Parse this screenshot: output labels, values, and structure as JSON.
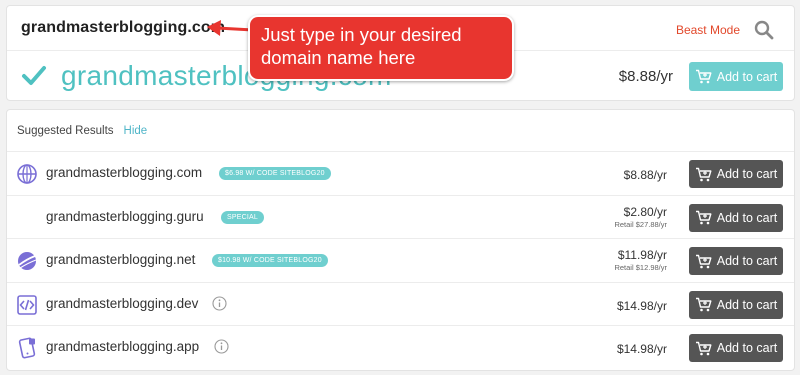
{
  "search": {
    "value": "grandmasterblogging.com",
    "beast_mode": "Beast Mode",
    "icon": "search-icon"
  },
  "main_result": {
    "domain": "grandmasterblogging.com",
    "price": "$8.88/yr",
    "button": "Add to cart",
    "status_icon": "check-icon"
  },
  "callout": {
    "line1": "Just type in your desired",
    "line2": "domain name here"
  },
  "suggestions": {
    "title": "Suggested Results",
    "hide": "Hide",
    "rows": [
      {
        "domain": "grandmasterblogging.com",
        "badge": "$6.98 W/ CODE SITEBLOG20",
        "price": "$8.88/yr",
        "retail": "",
        "button": "Add to cart",
        "icon": "globe-icon"
      },
      {
        "domain": "grandmasterblogging.guru",
        "badge": "SPECIAL",
        "price": "$2.80/yr",
        "retail": "Retail $27.88/yr",
        "button": "Add to cart",
        "icon": ""
      },
      {
        "domain": "grandmasterblogging.net",
        "badge": "$10.98 W/ CODE SITEBLOG20",
        "price": "$11.98/yr",
        "retail": "Retail $12.98/yr",
        "button": "Add to cart",
        "icon": "planet-icon"
      },
      {
        "domain": "grandmasterblogging.dev",
        "badge": "",
        "price": "$14.98/yr",
        "retail": "",
        "button": "Add to cart",
        "icon": "code-icon"
      },
      {
        "domain": "grandmasterblogging.app",
        "badge": "",
        "price": "$14.98/yr",
        "retail": "",
        "button": "Add to cart",
        "icon": "mobile-app-icon"
      }
    ]
  },
  "colors": {
    "teal": "#4fc1c1",
    "button_teal": "#6fcfcf",
    "button_dark": "#555555",
    "callout_red": "#e8352f",
    "beast_mode": "#e2482b",
    "icon_purple": "#7a6fd6"
  }
}
